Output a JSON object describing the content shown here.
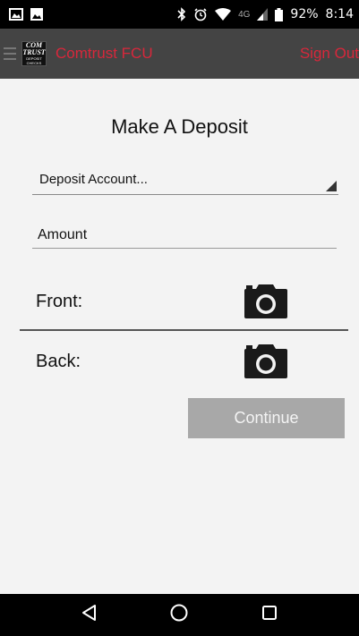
{
  "status_bar": {
    "battery_percent": "92%",
    "time": "8:14",
    "network": "4G"
  },
  "app_bar": {
    "title": "Comtrust FCU",
    "sign_out_label": "Sign Out",
    "logo_lines": [
      "COM",
      "TRUST",
      "DEPOSIT",
      "CHECKS"
    ]
  },
  "deposit": {
    "title": "Make A Deposit",
    "account_select_value": "Deposit Account...",
    "amount_placeholder": "Amount",
    "amount_value": "",
    "front_label": "Front:",
    "back_label": "Back:",
    "continue_label": "Continue"
  },
  "colors": {
    "app_bar_bg": "#444444",
    "brand_red": "#d8273b",
    "button_disabled": "#a8a8a8"
  },
  "icons": {
    "front_capture": "camera-icon",
    "back_capture": "camera-icon",
    "nav_back": "triangle-back-icon",
    "nav_home": "circle-home-icon",
    "nav_recent": "square-recent-icon"
  }
}
